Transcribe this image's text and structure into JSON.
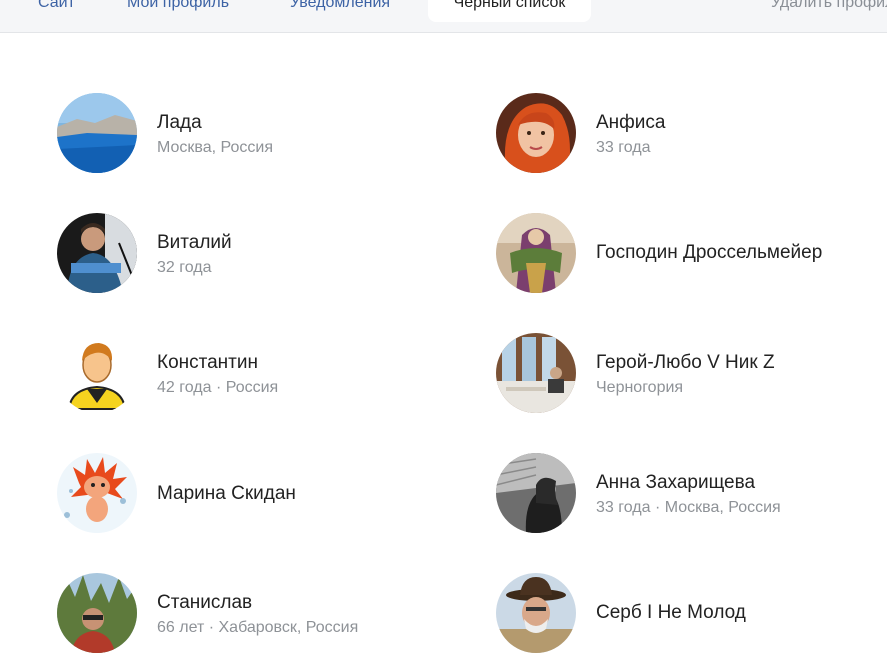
{
  "tabs": {
    "site": "Сайт",
    "profile": "Мой профиль",
    "notifications": "Уведомления",
    "blacklist": "Черный список",
    "delete_profile": "Удалить профиль"
  },
  "blacklist": {
    "left": [
      {
        "name": "Лада",
        "sub": "Москва, Россия",
        "avatar": "sea-cliff-photo"
      },
      {
        "name": "Виталий",
        "sub": "32 года",
        "avatar": "man-photo"
      },
      {
        "name": "Константин",
        "sub": "42 года · Россия",
        "avatar": "default-male-avatar"
      },
      {
        "name": "Марина Скидан",
        "sub": "",
        "avatar": "cartoon-hedgehog"
      },
      {
        "name": "Станислав",
        "sub": "66 лет · Хабаровск, Россия",
        "avatar": "man-outdoors-photo"
      }
    ],
    "right": [
      {
        "name": "Анфиса",
        "sub": "33 года",
        "avatar": "woman-redhead-photo"
      },
      {
        "name": "Господин Дроссельмейер",
        "sub": "",
        "avatar": "costume-figure-photo"
      },
      {
        "name": "Герой-Любо V Ник Z",
        "sub": "Черногория",
        "avatar": "restaurant-photo"
      },
      {
        "name": "Анна Захарищева",
        "sub": "33 года · Москва, Россия",
        "avatar": "woman-bw-photo"
      },
      {
        "name": "Серб I Не Молод",
        "sub": "",
        "avatar": "man-cowboy-hat-photo"
      }
    ]
  }
}
